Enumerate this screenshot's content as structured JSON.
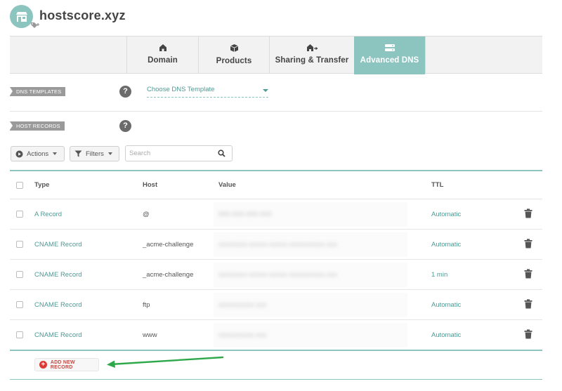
{
  "header": {
    "domain_name": "hostscore.xyz",
    "avatar_icon": "store-icon",
    "tag_icon": "tag-add-icon"
  },
  "tabs": [
    {
      "label": "Domain",
      "icon": "home-icon",
      "active": false
    },
    {
      "label": "Products",
      "icon": "box-icon",
      "active": false
    },
    {
      "label": "Sharing & Transfer",
      "icon": "house-arrow-icon",
      "active": false
    },
    {
      "label": "Advanced DNS",
      "icon": "server-icon",
      "active": true
    }
  ],
  "sections": {
    "dns_templates": {
      "label": "DNS TEMPLATES",
      "help": "?"
    },
    "host_records": {
      "label": "HOST RECORDS",
      "help": "?"
    }
  },
  "template_select": {
    "value": "Choose DNS Template"
  },
  "toolbar": {
    "actions_label": "Actions",
    "filters_label": "Filters",
    "search_placeholder": "Search"
  },
  "table": {
    "columns": {
      "type": "Type",
      "host": "Host",
      "value": "Value",
      "ttl": "TTL"
    },
    "rows": [
      {
        "type": "A Record",
        "host": "@",
        "value": "000.000.000.000",
        "ttl": "Automatic"
      },
      {
        "type": "CNAME Record",
        "host": "_acme-challenge",
        "value": "xxxxxxxx-xxxxx-xxxxx.xxxxxxxxxx.xxx",
        "ttl": "Automatic"
      },
      {
        "type": "CNAME Record",
        "host": "_acme-challenge",
        "value": "xxxxxxxx-xxxxx-xxxxx.xxxxxxxxxx.xxx",
        "ttl": "1 min"
      },
      {
        "type": "CNAME Record",
        "host": "ftp",
        "value": "xxxxxxxxxx.xxx",
        "ttl": "Automatic"
      },
      {
        "type": "CNAME Record",
        "host": "www",
        "value": "xxxxxxxxxx.xxx",
        "ttl": "Automatic"
      }
    ]
  },
  "add_record": {
    "label": "ADD NEW RECORD"
  },
  "colors": {
    "accent": "#8cc4c0",
    "link": "#4e9a95",
    "add_red": "#dc3a34",
    "arrow_green": "#2ea84a"
  }
}
